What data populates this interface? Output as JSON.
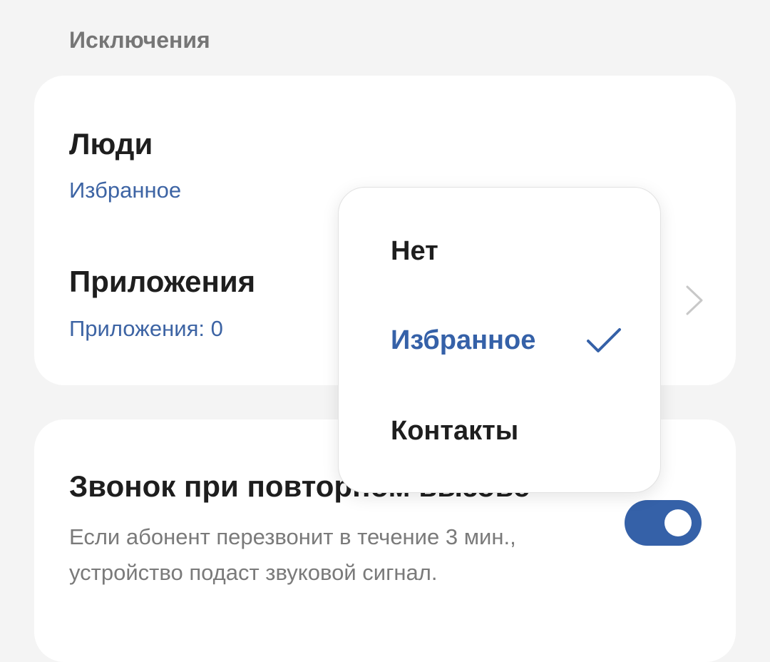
{
  "section": {
    "title": "Исключения"
  },
  "exceptions": {
    "people": {
      "title": "Люди",
      "value": "Избранное"
    },
    "apps": {
      "title": "Приложения",
      "value": "Приложения: 0"
    }
  },
  "repeat_call": {
    "title": "Звонок при повторном вызове",
    "description": "Если абонент перезвонит в течение 3 мин., устройство подаст звуковой сигнал.",
    "enabled": true
  },
  "dropdown": {
    "options": [
      "Нет",
      "Избранное",
      "Контакты"
    ],
    "selected": "Избранное"
  },
  "colors": {
    "accent": "#3561a8",
    "link": "#3d64a4",
    "background": "#f4f4f4",
    "card": "#ffffff"
  },
  "icons": {
    "chevron": "chevron-right-icon",
    "check": "check-icon"
  }
}
